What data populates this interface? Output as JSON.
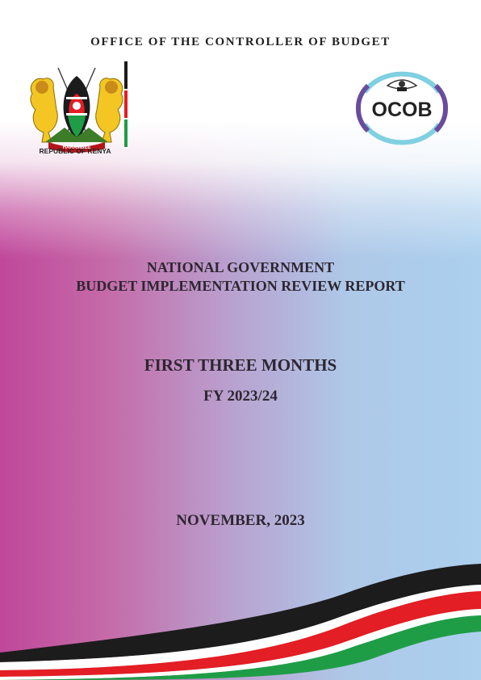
{
  "header": {
    "office_name": "OFFICE OF THE CONTROLLER OF BUDGET"
  },
  "coat_of_arms": {
    "caption": "REPUBLIC OF KENYA",
    "motto": "HARAMBEE"
  },
  "ocob_logo": {
    "text": "OCOB"
  },
  "report": {
    "line1": "NATIONAL GOVERNMENT",
    "line2": "BUDGET IMPLEMENTATION REVIEW REPORT",
    "period": "FIRST THREE MONTHS",
    "fiscal_year": "FY 2023/24",
    "date": "NOVEMBER, 2023"
  },
  "colors": {
    "flag_black": "#1c1c1c",
    "flag_red": "#e31e24",
    "flag_green": "#1f9d46",
    "logo_purple": "#6a4c9c",
    "logo_cyan": "#7fd0e0",
    "magenta": "#c0479b",
    "sky_blue": "#acd0ee"
  }
}
